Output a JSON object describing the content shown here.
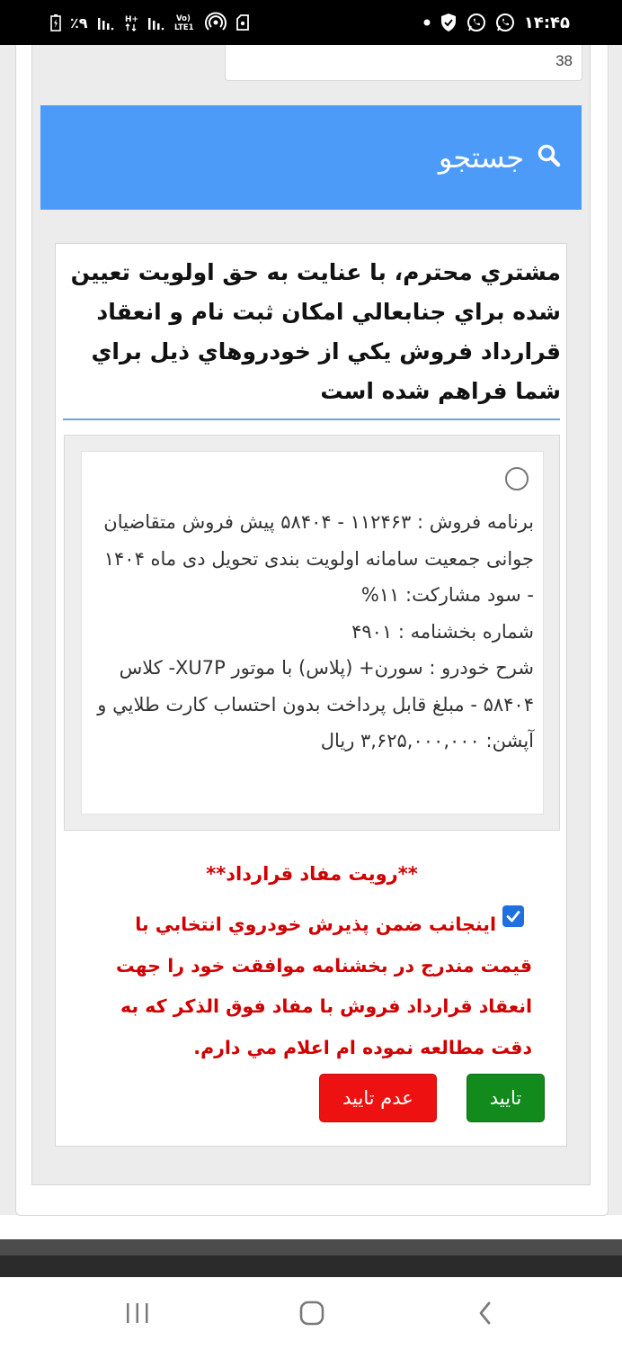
{
  "status_bar": {
    "time": "۱۴:۴۵",
    "battery_percent": "٪۹",
    "volte_label": "Vo) LTE1"
  },
  "top_field": {
    "value": "38"
  },
  "search": {
    "label": "جستجو",
    "icon": "search-icon"
  },
  "notice": {
    "heading": "مشتري محترم، با عنايت به حق اولويت تعيين شده براي جنابعالي امكان ثبت نام و انعقاد قرارداد فروش يكي از خودروهاي ذيل براي شما فراهم شده است"
  },
  "option": {
    "selected": false,
    "line1": "برنامه فروش : ۱۱۲۴۶۳ - ۵۸۴۰۴ پیش فروش متقاضیان جوانی جمعیت سامانه اولویت بندی تحویل دی ماه ۱۴۰۴ - سود مشارکت: ۱۱%",
    "line2": "شماره بخشنامه : ۴۹۰۱",
    "line3": "شرح خودرو : سورن+ (پلاس) با موتور XU7P- کلاس ۵۸۴۰۴ - مبلغ قابل پرداخت بدون احتساب کارت طلايي و آپشن: ۳,۶۲۵,۰۰۰,۰۰۰ ریال"
  },
  "terms": {
    "title": "**رويت مفاد قرارداد**",
    "checked": true,
    "text": "اينجانب ضمن پذيرش خودروي انتخابي با قيمت مندرج در بخشنامه موافقت خود را جهت انعقاد قرارداد فروش با مفاد فوق الذكر كه به دقت مطالعه نموده ام اعلام مي دارم."
  },
  "buttons": {
    "confirm": "تایید",
    "reject": "عدم تایید"
  },
  "colors": {
    "search_bar": "#4d9bf8",
    "confirm": "#128a1c",
    "reject": "#ee1111",
    "terms_text": "#d10000",
    "checkbox": "#1e6fe0"
  }
}
